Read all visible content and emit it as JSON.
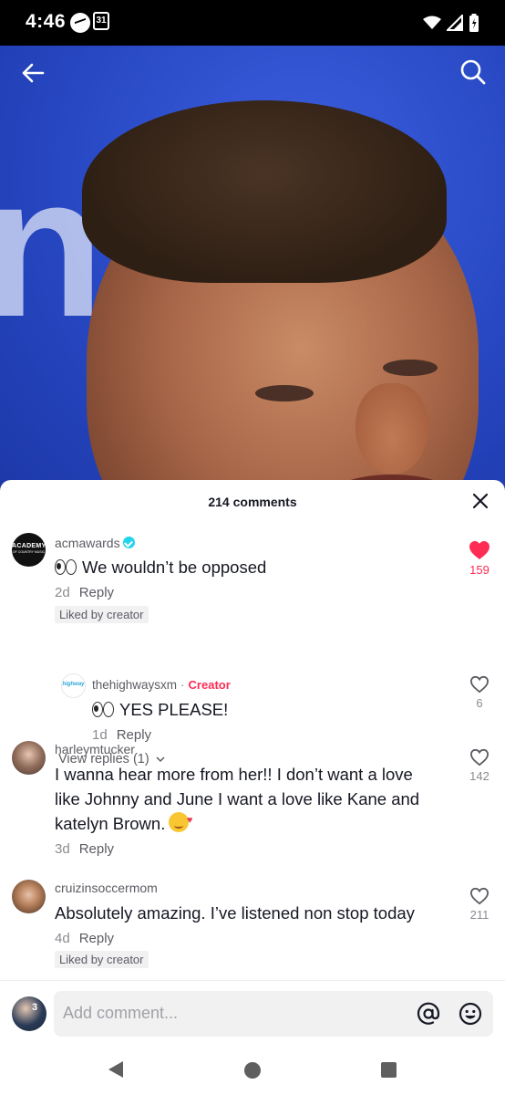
{
  "status_bar": {
    "time": "4:46",
    "calendar_day": "31"
  },
  "sheet": {
    "title": "214 comments"
  },
  "comments": [
    {
      "username": "acmawards",
      "verified": true,
      "text": "We wouldn’t be opposed",
      "age": "2d",
      "reply_label": "Reply",
      "liked_by_creator": "Liked by creator",
      "likes": "159",
      "liked": true,
      "replies": [
        {
          "username": "thehighwaysxm",
          "creator_label": "Creator",
          "text": "YES PLEASE!",
          "age": "1d",
          "reply_label": "Reply",
          "likes": "6"
        }
      ],
      "view_replies": "View replies (1)"
    },
    {
      "username": "harleymtucker",
      "text_lines": [
        "I wanna hear more from her!! I don’t want a love",
        "like Johnny and June I want a love like Kane and",
        "katelyn Brown."
      ],
      "age": "3d",
      "reply_label": "Reply",
      "likes": "142"
    },
    {
      "username": "cruizinsoccermom",
      "text": "Absolutely amazing. I’ve listened non stop today",
      "age": "4d",
      "reply_label": "Reply",
      "liked_by_creator": "Liked by creator",
      "likes": "211"
    }
  ],
  "input": {
    "placeholder": "Add comment..."
  },
  "avatar_texts": {
    "acm_line1": "ACADEMY",
    "acm_line2": "OF COUNTRY MUSIC",
    "highway": "highway",
    "self_badge": "3"
  },
  "colors": {
    "accent": "#fe2c55",
    "verified": "#20d5ec",
    "video_bg": "#2f4fc8"
  },
  "icons": [
    "back-arrow-icon",
    "search-icon",
    "close-icon",
    "heart-icon",
    "chevron-down-icon",
    "at-sign-icon",
    "emoji-icon",
    "nav-back-icon",
    "nav-home-icon",
    "nav-recents-icon"
  ]
}
